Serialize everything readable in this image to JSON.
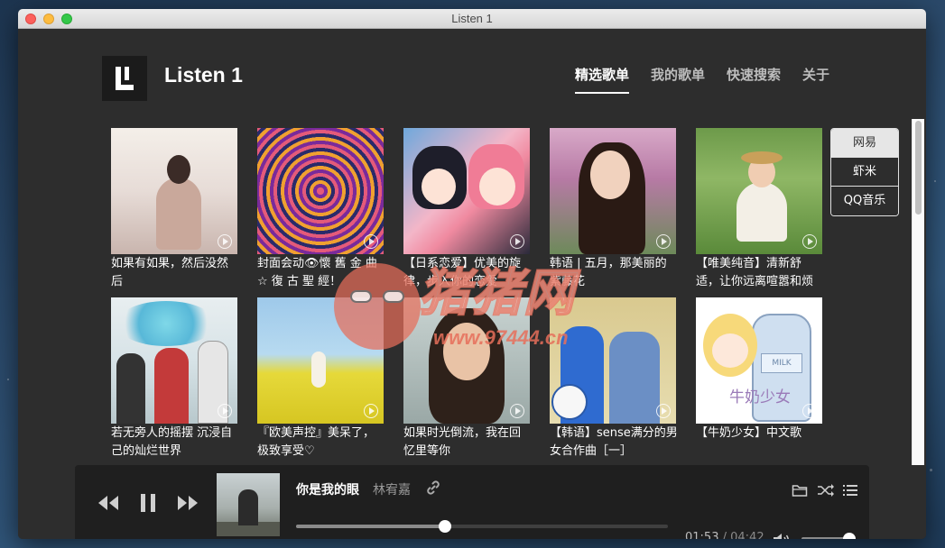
{
  "window": {
    "title": "Listen 1"
  },
  "app": {
    "name": "Listen 1"
  },
  "nav": [
    {
      "label": "精选歌单",
      "active": true
    },
    {
      "label": "我的歌单",
      "active": false
    },
    {
      "label": "快速搜索",
      "active": false
    },
    {
      "label": "关于",
      "active": false
    }
  ],
  "sources": [
    {
      "label": "网易",
      "active": true
    },
    {
      "label": "虾米",
      "active": false
    },
    {
      "label": "QQ音乐",
      "active": false
    }
  ],
  "playlists": [
    {
      "title": "如果有如果，然后没然后"
    },
    {
      "title": "封面会动👁懷 舊 金 曲☆ 復 古 聖 經！"
    },
    {
      "title": "【日系恋爱】优美的旋律，步入你的恋爱"
    },
    {
      "title": "韩语 | 五月，那美丽的紫藤花"
    },
    {
      "title": "【唯美纯音】清新舒适，让你远离喧嚣和烦恼"
    },
    {
      "title": "若无旁人的摇摆 沉浸自己的灿烂世界"
    },
    {
      "title": "『欧美声控』美呆了，极致享受♡"
    },
    {
      "title": "如果时光倒流，我在回忆里等你"
    },
    {
      "title": "【韩语】sense满分的男女合作曲［一］"
    },
    {
      "title": "【牛奶少女】中文歌"
    }
  ],
  "cover_art": {
    "bottle_label": "MILK",
    "caption": "牛奶少女"
  },
  "player": {
    "song": "你是我的眼",
    "artist": "林宥嘉",
    "current_time": "01:53",
    "separator": " / ",
    "total_time": "04:42",
    "progress": 0.4,
    "volume": 0.88
  },
  "watermark": {
    "text": "猪猪网",
    "url": "www.97444.cn"
  }
}
